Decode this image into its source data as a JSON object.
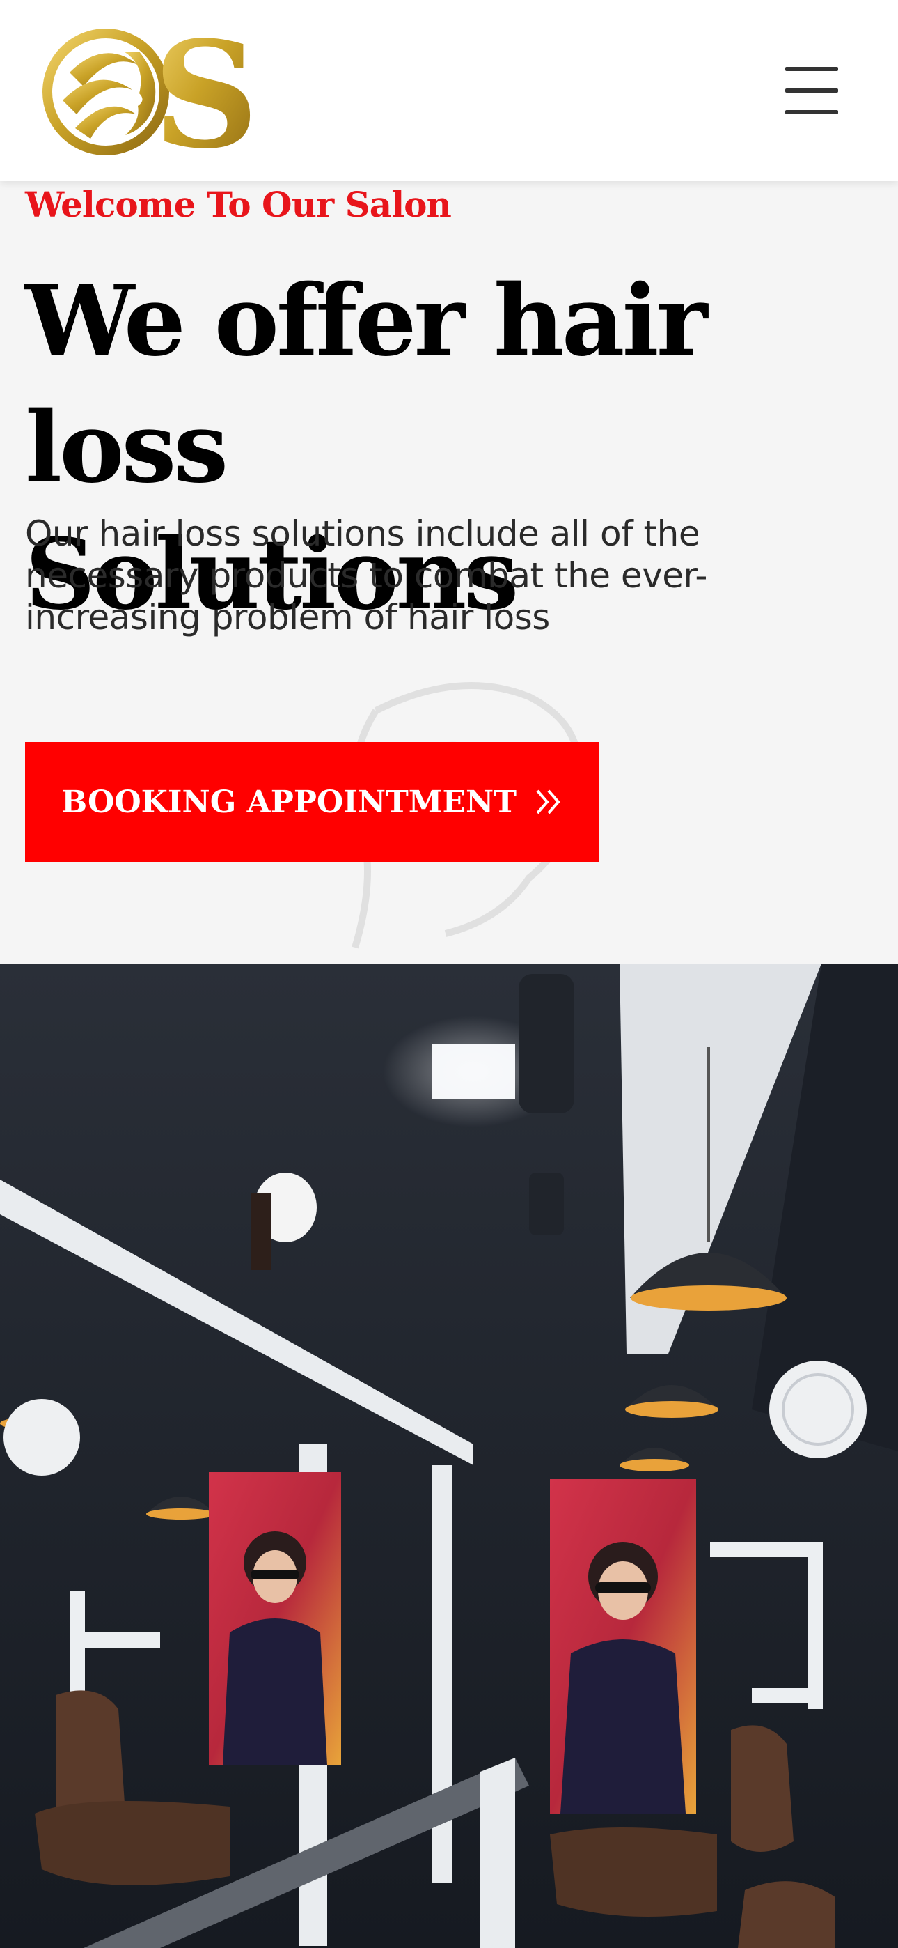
{
  "header": {
    "logo_icon": "salon-logo-icon",
    "menu_icon": "hamburger-menu-icon"
  },
  "hero": {
    "welcome": "Welcome To Our Salon",
    "headline_line1": "We offer hair loss",
    "headline_line2": "Solutions",
    "description": "Our hair loss solutions include all of the necessary products to combat the ever-increasing problem of hair loss",
    "cta_label": "BOOKING APPOINTMENT",
    "cta_icon": "double-chevron-right-icon"
  },
  "colors": {
    "accent_red": "#ff0000",
    "welcome_red": "#e8151b",
    "logo_gold": "#c9a227"
  }
}
